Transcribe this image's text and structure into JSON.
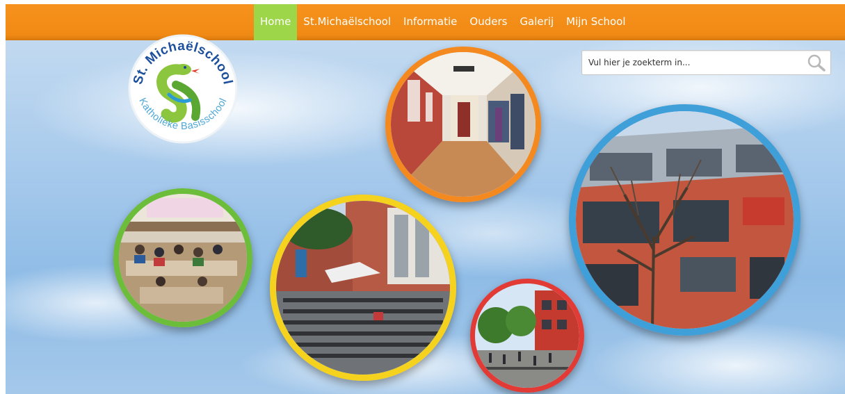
{
  "nav": {
    "items": [
      {
        "label": "Home",
        "active": true
      },
      {
        "label": "St.Michaëlschool",
        "active": false
      },
      {
        "label": "Informatie",
        "active": false
      },
      {
        "label": "Ouders",
        "active": false
      },
      {
        "label": "Galerij",
        "active": false
      },
      {
        "label": "Mijn School",
        "active": false
      }
    ]
  },
  "search": {
    "placeholder": "Vul hier je zoekterm in...",
    "icon": "search-icon"
  },
  "logo": {
    "top_text": "St. Michaëlschool",
    "bottom_text": "Katholieke Basisschool",
    "icon": "snake-logo-icon"
  },
  "colors": {
    "nav_bar": "#f7921e",
    "nav_active": "#9ed64a",
    "ring_orange": "#f4891f",
    "ring_blue": "#3f9fd9",
    "ring_green": "#6cbd3a",
    "ring_yellow": "#f5d21d",
    "ring_red": "#e23b36"
  }
}
